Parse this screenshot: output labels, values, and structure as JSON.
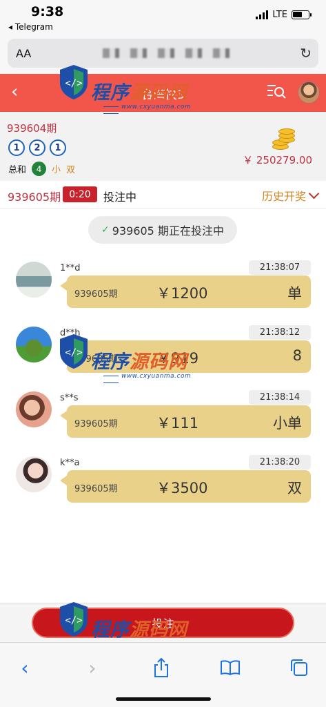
{
  "status_bar": {
    "time": "9:38",
    "back_app": "◂ Telegram",
    "network": "LTE"
  },
  "address_bar": {
    "text_size_label": "AA"
  },
  "header": {
    "title": "台湾快3"
  },
  "last_draw": {
    "period": "939604期",
    "balls": [
      "1",
      "2",
      "1"
    ],
    "sum_label": "总和",
    "sum_value": "4",
    "size": "小",
    "parity": "双",
    "balance": "￥ 250279.00"
  },
  "current": {
    "period": "939605期",
    "countdown": "0:20",
    "status": "投注中",
    "history_label": "历史开奖"
  },
  "notice": {
    "text": "939605 期正在投注中"
  },
  "bets": [
    {
      "user": "1**d",
      "time": "21:38:07",
      "period": "939605期",
      "amount": "￥1200",
      "choice": "单"
    },
    {
      "user": "d**h",
      "time": "21:38:12",
      "period": "939605期",
      "amount": "￥919",
      "choice": "8"
    },
    {
      "user": "s**s",
      "time": "21:38:14",
      "period": "939605期",
      "amount": "￥111",
      "choice": "小单"
    },
    {
      "user": "k**a",
      "time": "21:38:20",
      "period": "939605期",
      "amount": "￥3500",
      "choice": "双"
    }
  ],
  "bet_button": {
    "label": "投注"
  },
  "watermark": {
    "brand_a": "程序",
    "brand_b": "源码网",
    "url": "www.cxyuanma.com"
  },
  "colors": {
    "header": "#f2564a",
    "accent_red": "#c0323f",
    "bubble": "#ead18a",
    "button": "#c8161d"
  }
}
